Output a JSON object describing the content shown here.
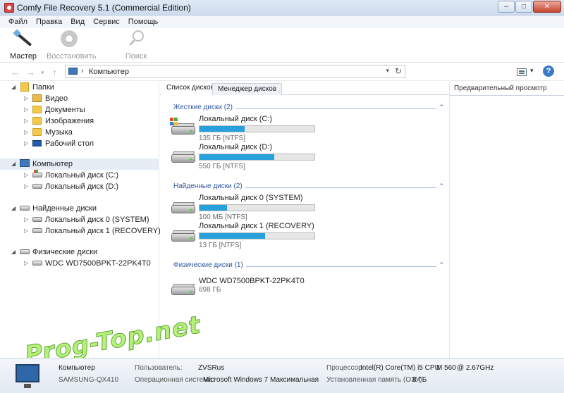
{
  "window": {
    "title": "Comfy File Recovery 5.1 (Commercial Edition)",
    "min": "–",
    "max": "□",
    "close": "✕"
  },
  "menu": [
    "Файл",
    "Правка",
    "Вид",
    "Сервис",
    "Помощь"
  ],
  "toolbar": {
    "wizard": "Мастер",
    "restore": "Восстановить",
    "search": "Поиск"
  },
  "address": {
    "path": "Компьютер",
    "separator": "›"
  },
  "tree": {
    "folders_label": "Папки",
    "folders": [
      "Видео",
      "Документы",
      "Изображения",
      "Музыка",
      "Рабочий стол"
    ],
    "computer_label": "Компьютер",
    "computer_drives": [
      "Локальный диск (C:)",
      "Локальный диск (D:)"
    ],
    "found_label": "Найденные диски",
    "found_drives": [
      "Локальный диск 0 (SYSTEM)",
      "Локальный диск 1 (RECOVERY)"
    ],
    "physical_label": "Физические диски",
    "physical_drives": [
      "WDC WD7500BPKT-22PK4T0"
    ]
  },
  "tabs": {
    "disk_list": "Список дисков",
    "disk_manager": "Менеджер дисков"
  },
  "sections": {
    "hard": {
      "title": "Жесткие диски (2)",
      "items": [
        {
          "name": "Локальный диск (C:)",
          "info": "135 ГБ [NTFS]",
          "fill": 0.39
        },
        {
          "name": "Локальный диск (D:)",
          "info": "550 ГБ [NTFS]",
          "fill": 0.65
        }
      ]
    },
    "found": {
      "title": "Найденные диски (2)",
      "items": [
        {
          "name": "Локальный диск 0 (SYSTEM)",
          "info": "100 МБ [NTFS]",
          "fill": 0.24
        },
        {
          "name": "Локальный диск 1 (RECOVERY)",
          "info": "13 ГБ [NTFS]",
          "fill": 0.57
        }
      ]
    },
    "physical": {
      "title": "Физические диски (1)",
      "items": [
        {
          "name": "WDC WD7500BPKT-22PK4T0",
          "info": "698 ГБ"
        }
      ]
    }
  },
  "preview": {
    "title": "Предварительный просмотр"
  },
  "status": {
    "computer": "Компьютер",
    "computer_name": "SAMSUNG-QX410",
    "user_label": "Пользователь:",
    "user": "ZVSRus",
    "os_label": "Операционная система:",
    "os": "Microsoft Windows 7 Максимальная",
    "cpu_label": "Процессор:",
    "cpu": "Intel(R) Core(TM) i5 CPU",
    "cpu_model": "M 560",
    "cpu_freq": "@ 2.67GHz",
    "ram_label": "Установленная память (ОЗУ):",
    "ram": "8 ГБ"
  },
  "watermark": "Prog-Top.net",
  "colors": {
    "accent": "#27a0dc",
    "section_title": "#2c56a0"
  }
}
